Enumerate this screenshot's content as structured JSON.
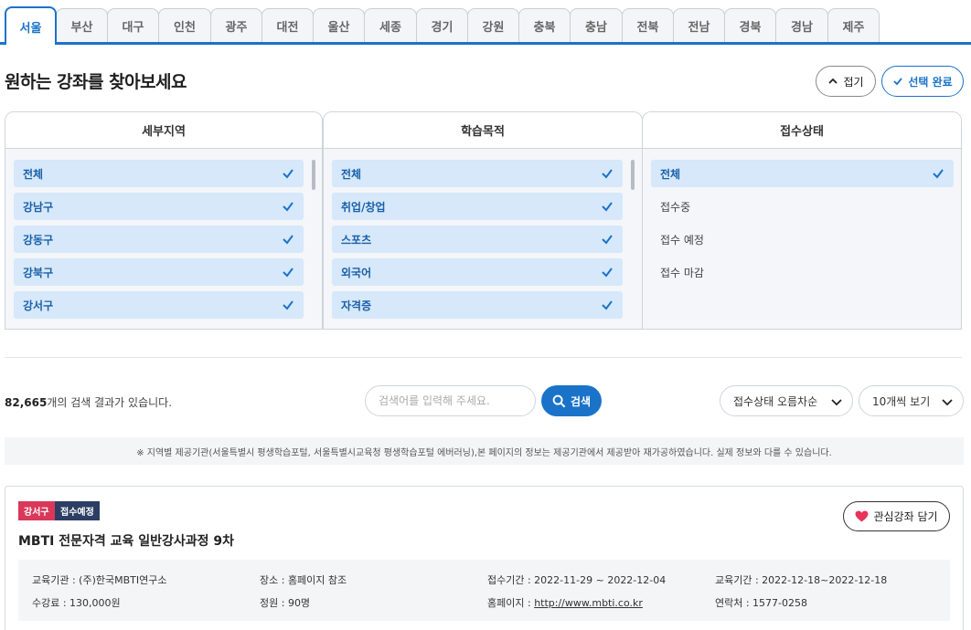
{
  "tabs": [
    {
      "label": "서울",
      "active": true
    },
    {
      "label": "부산"
    },
    {
      "label": "대구"
    },
    {
      "label": "인천"
    },
    {
      "label": "광주"
    },
    {
      "label": "대전"
    },
    {
      "label": "울산"
    },
    {
      "label": "세종"
    },
    {
      "label": "경기"
    },
    {
      "label": "강원"
    },
    {
      "label": "충북"
    },
    {
      "label": "충남"
    },
    {
      "label": "전북"
    },
    {
      "label": "전남"
    },
    {
      "label": "경북"
    },
    {
      "label": "경남"
    },
    {
      "label": "제주"
    }
  ],
  "header": {
    "title": "원하는 강좌를 찾아보세요",
    "fold_label": "접기",
    "done_label": "선택 완료"
  },
  "filters": {
    "region": {
      "title": "세부지역",
      "options": [
        {
          "label": "전체",
          "selected": true
        },
        {
          "label": "강남구",
          "selected": true
        },
        {
          "label": "강동구",
          "selected": true
        },
        {
          "label": "강북구",
          "selected": true
        },
        {
          "label": "강서구",
          "selected": true
        }
      ]
    },
    "purpose": {
      "title": "학습목적",
      "options": [
        {
          "label": "전체",
          "selected": true
        },
        {
          "label": "취업/창업",
          "selected": true
        },
        {
          "label": "스포츠",
          "selected": true
        },
        {
          "label": "외국어",
          "selected": true
        },
        {
          "label": "자격증",
          "selected": true
        }
      ]
    },
    "status": {
      "title": "접수상태",
      "options": [
        {
          "label": "전체",
          "selected": true
        },
        {
          "label": "접수중",
          "selected": false
        },
        {
          "label": "접수 예정",
          "selected": false
        },
        {
          "label": "접수 마감",
          "selected": false
        }
      ]
    }
  },
  "results": {
    "count": "82,665",
    "count_suffix": "개의 검색 결과가 있습니다.",
    "search_placeholder": "검색어를 입력해 주세요.",
    "search_label": "검색",
    "sort_value": "접수상태 오름차순",
    "page_size_value": "10개씩 보기"
  },
  "notice": "※ 지역별 제공기관(서울특별시 평생학습포털, 서울특별시교육청 평생학습포털 에버러닝),본 페이지의 정보는 제공기관에서 제공받아 재가공하였습니다. 실제 정보와 다를 수 있습니다.",
  "course": {
    "region_badge": "강서구",
    "status_badge": "접수예정",
    "title": "MBTI 전문자격 교육 일반강사과정 9차",
    "fav_label": "관심강좌 담기",
    "institution": "교육기관 : (주)한국MBTI연구소",
    "place": "장소 : 홈페이지 참조",
    "apply_period": "접수기간 : 2022-11-29 ~ 2022-12-04",
    "edu_period": "교육기간 : 2022-12-18~2022-12-18",
    "fee": "수강료 : 130,000원",
    "capacity": "정원 : 90명",
    "homepage_prefix": "홈페이지 : ",
    "homepage_url": "http://www.mbti.co.kr",
    "contact": "연락처 : 1577-0258"
  },
  "colors": {
    "accent": "#1a73c9",
    "selected_bg": "#d6e8fa",
    "badge_region": "#d9385a",
    "badge_status": "#2c3e63",
    "heart": "#e8345a"
  }
}
